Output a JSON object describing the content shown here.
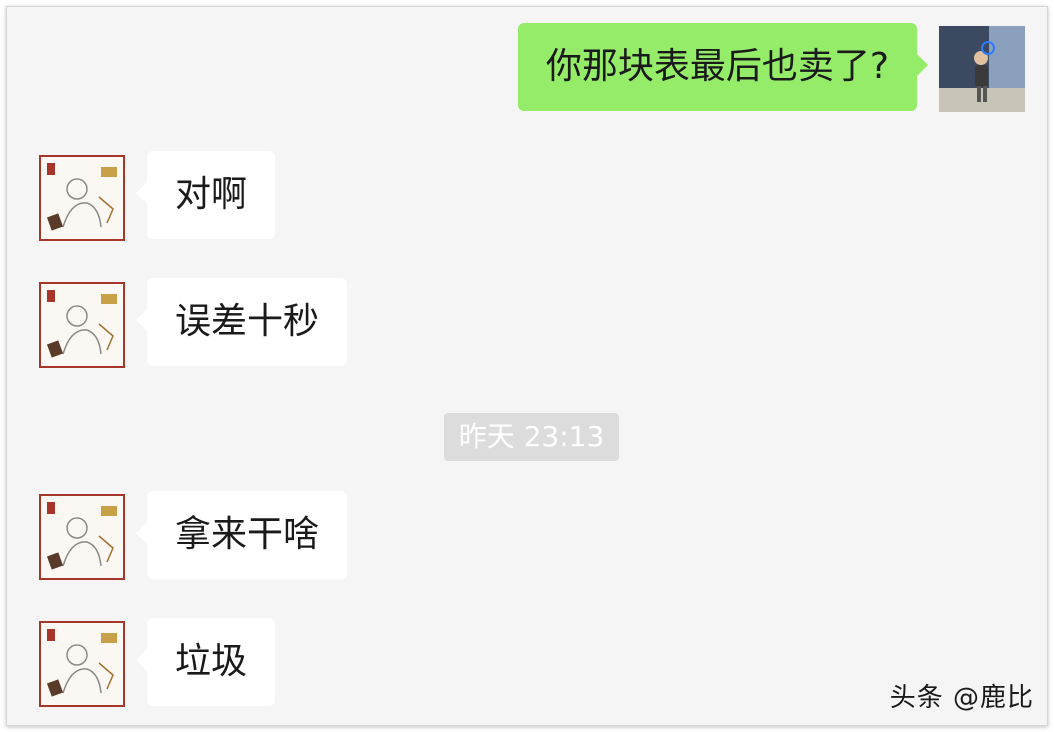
{
  "messages": [
    {
      "sender": "self",
      "text": "你那块表最后也卖了?"
    },
    {
      "sender": "friend",
      "text": "对啊"
    },
    {
      "sender": "friend",
      "text": "误差十秒"
    },
    {
      "sender": "friend",
      "text": "拿来干啥"
    },
    {
      "sender": "friend",
      "text": "垃圾"
    }
  ],
  "timestamp": "昨天 23:13",
  "watermark": "头条 @鹿比",
  "colors": {
    "outgoing_bubble": "#95ec69",
    "incoming_bubble": "#ffffff",
    "background": "#f5f5f5"
  },
  "icons": {
    "friend_avatar": "cartoon-couple-avatar-icon",
    "self_avatar": "photo-avatar-icon"
  }
}
